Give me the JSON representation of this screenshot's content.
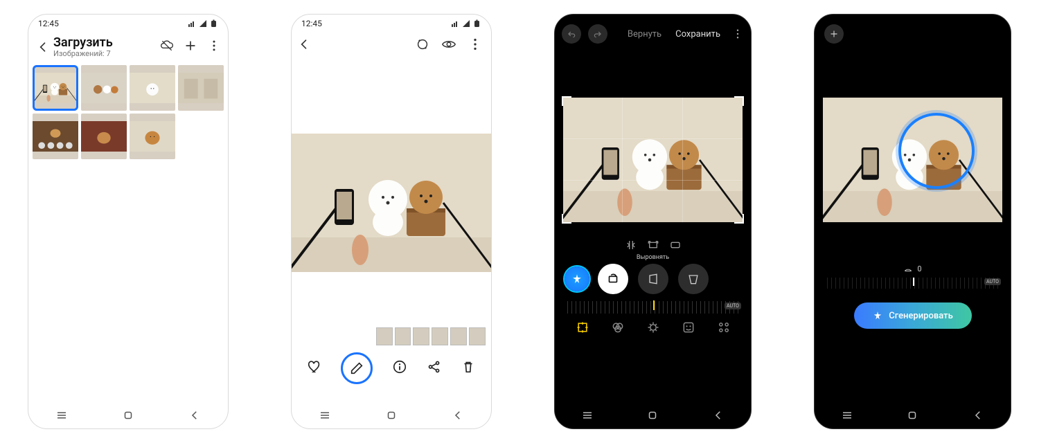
{
  "screen1": {
    "time": "12:45",
    "title": "Загрузить",
    "subtitle": "Изображений: 7",
    "thumb_count": 7
  },
  "screen2": {
    "time": "12:45"
  },
  "screen3": {
    "revert_label": "Вернуть",
    "save_label": "Сохранить",
    "straighten_label": "Выровнять",
    "auto_label": "AUTO"
  },
  "screen4": {
    "angle_value": "0",
    "auto_label": "AUTO",
    "generate_label": "Сгенерировать"
  }
}
